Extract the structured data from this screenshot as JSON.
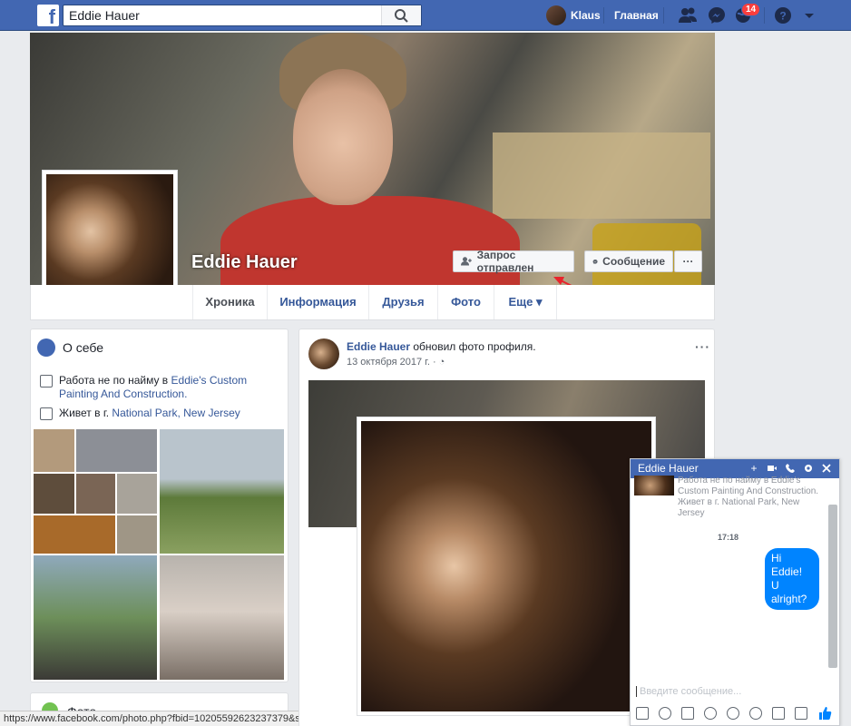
{
  "topbar": {
    "logo": "f",
    "search_value": "Eddie Hauer",
    "user_name": "Klaus",
    "home_label": "Главная",
    "notification_count": "14"
  },
  "profile": {
    "name": "Eddie Hauer",
    "friend_request_label": "Запрос отправлен",
    "message_label": "Сообщение",
    "more_label": "···"
  },
  "tabs": [
    {
      "label": "Хроника"
    },
    {
      "label": "Информация"
    },
    {
      "label": "Друзья"
    },
    {
      "label": "Фото"
    },
    {
      "label": "Еще ▾"
    }
  ],
  "about": {
    "title": "О себе",
    "work_prefix": "Работа не по найму в ",
    "work_link": "Eddie's Custom Painting And Construction.",
    "lives_prefix": "Живет в г. ",
    "lives_link": "National Park, New Jersey"
  },
  "photos_section_title": "Фото",
  "status_url": "https://www.facebook.com/photo.php?fbid=10205592623237379&set=picfp.13070...",
  "post": {
    "author": "Eddie Hauer",
    "action": " обновил фото профиля.",
    "date": "13 октября 2017 г. · ◔",
    "menu": "···"
  },
  "chat": {
    "title": "Eddie Hauer",
    "info": "Работа не по найму в Eddie's Custom Painting And Construction. Живет в г. National Park, New Jersey",
    "time": "17:18",
    "message": "Hi Eddie! U alright?",
    "input_placeholder": "Введите сообщение..."
  },
  "colors": {
    "brand": "#4267b2",
    "link": "#365899",
    "bubble": "#0084ff",
    "badge": "#fa3e3e"
  }
}
